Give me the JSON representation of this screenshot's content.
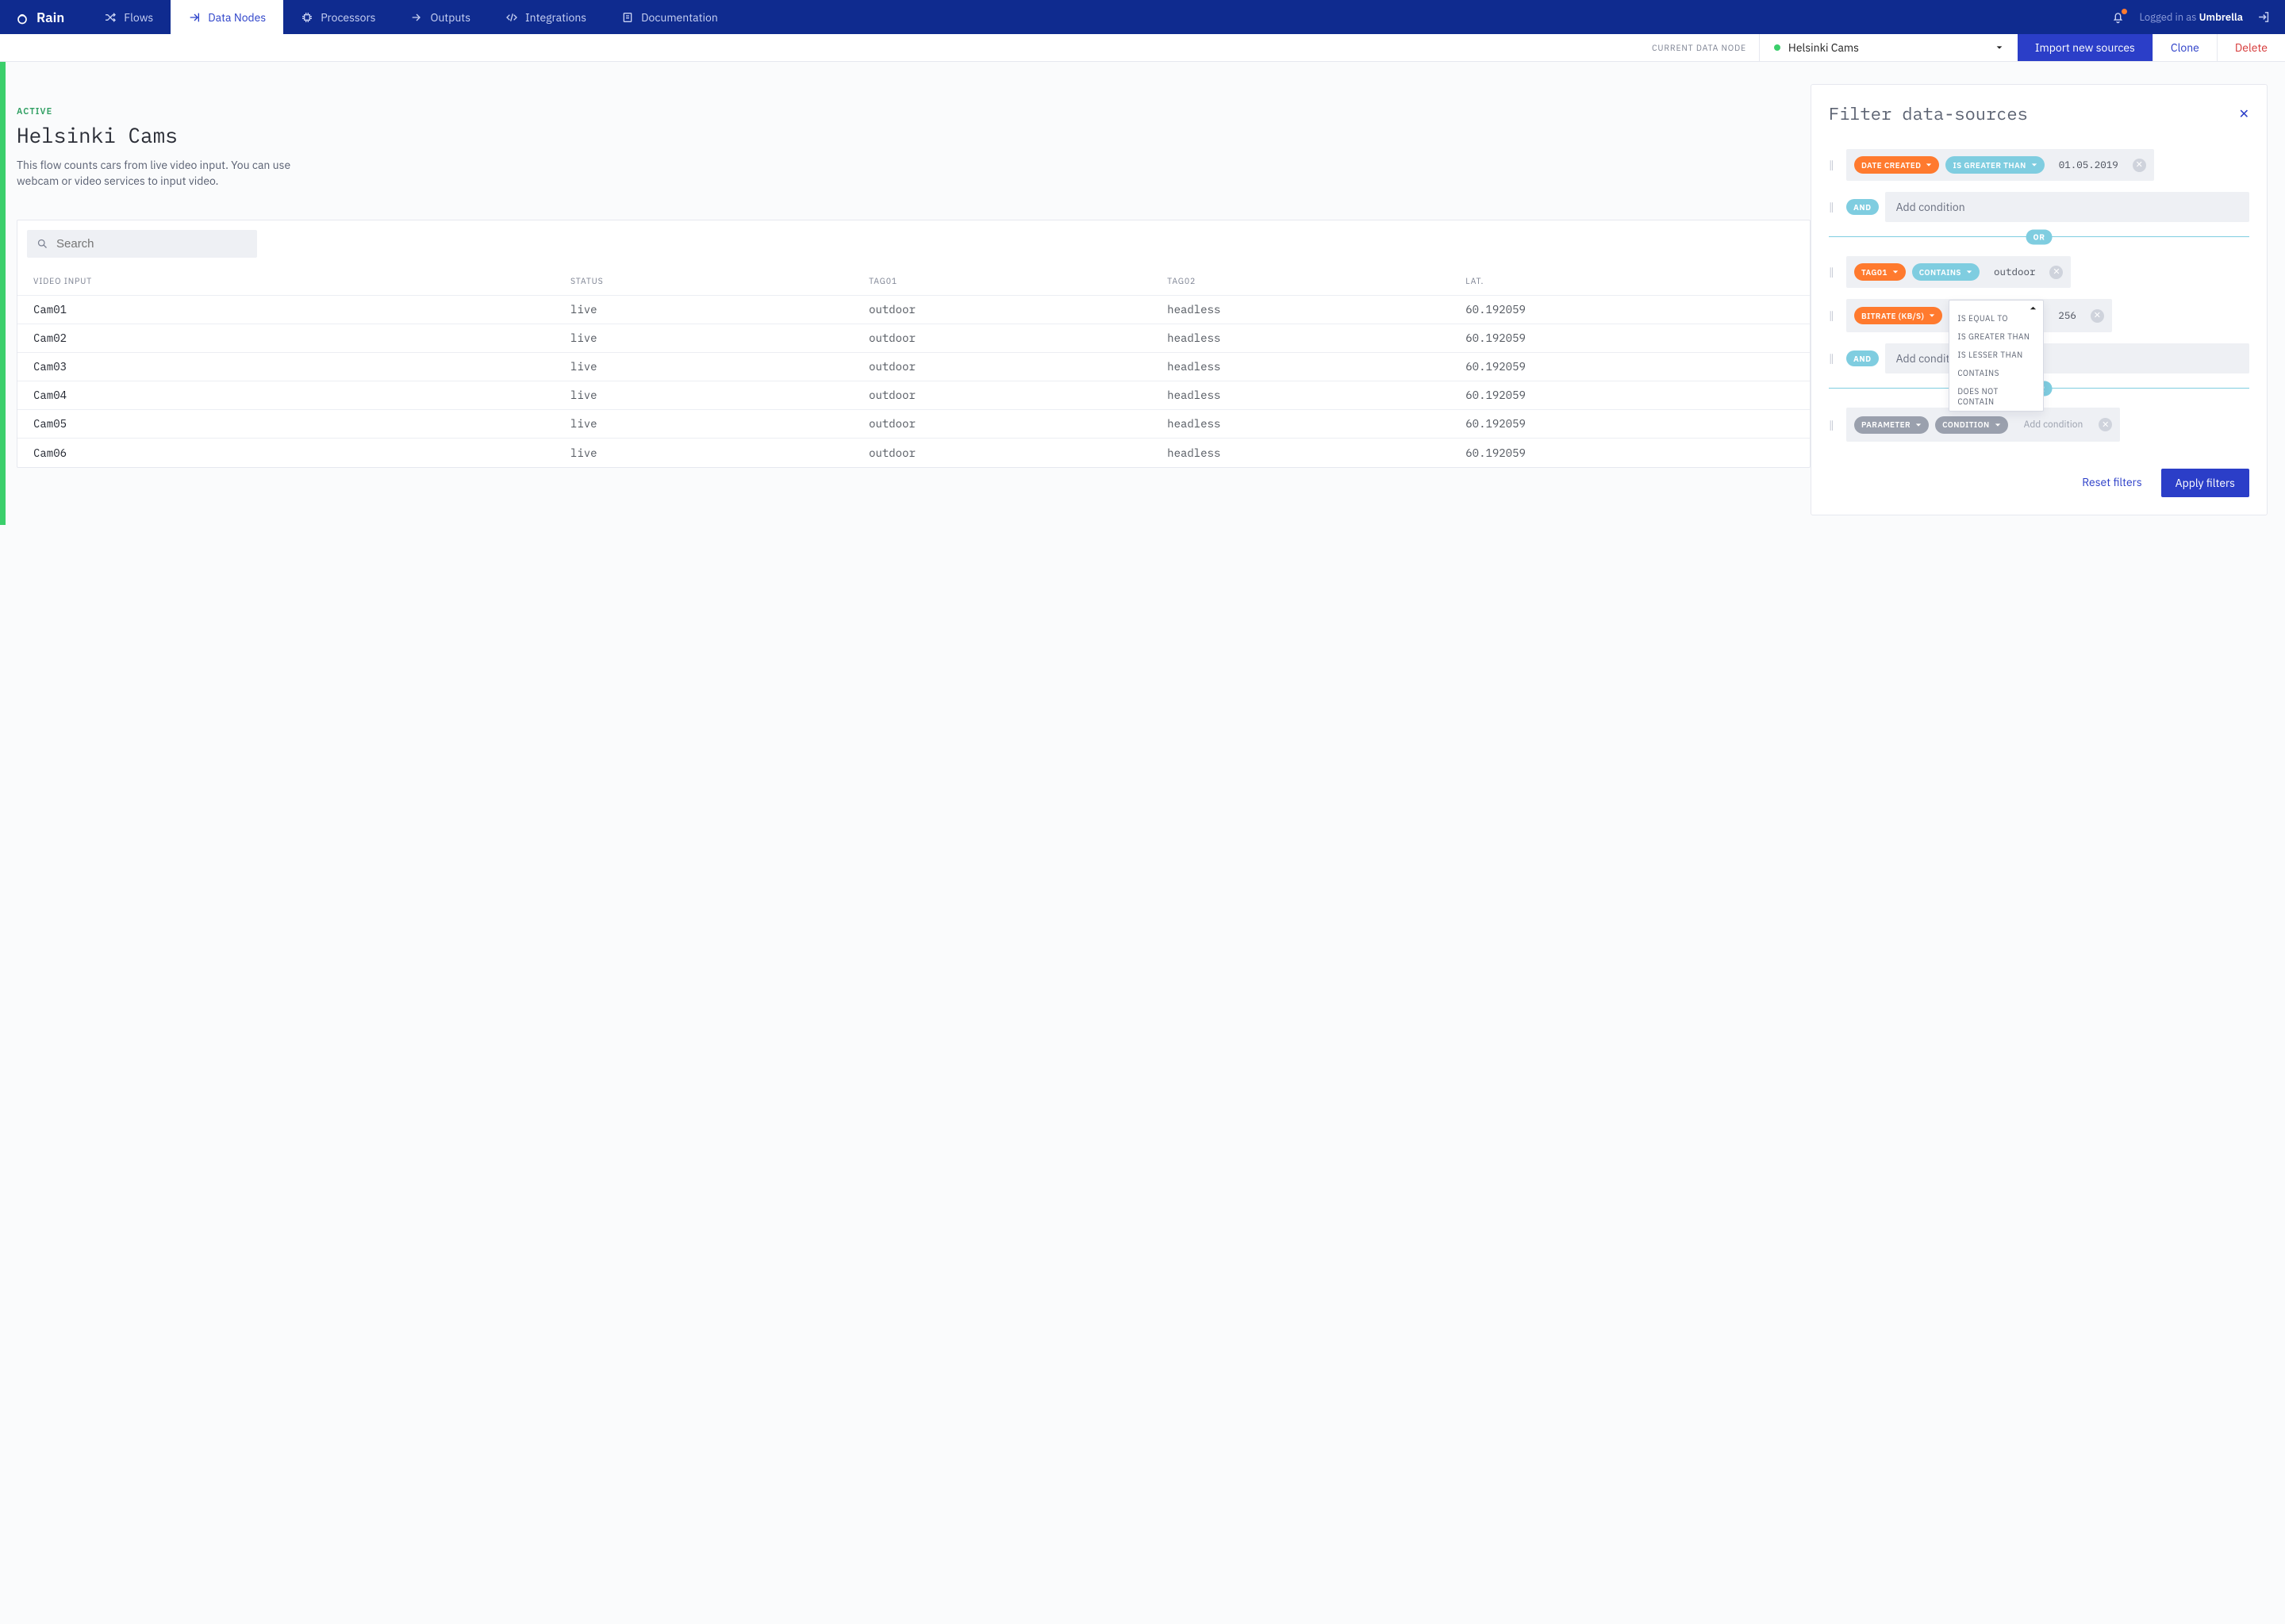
{
  "brand": "Rain",
  "nav": {
    "items": [
      {
        "label": "Flows"
      },
      {
        "label": "Data Nodes",
        "active": true
      },
      {
        "label": "Processors"
      },
      {
        "label": "Outputs"
      },
      {
        "label": "Integrations"
      },
      {
        "label": "Documentation"
      }
    ]
  },
  "auth": {
    "prefix": "Logged in as ",
    "name": "Umbrella"
  },
  "subbar": {
    "label": "CURRENT DATA NODE",
    "node_name": "Helsinki Cams",
    "import": "Import new sources",
    "clone": "Clone",
    "delete": "Delete"
  },
  "hero": {
    "status": "ACTIVE",
    "title": "Helsinki Cams",
    "desc": "This flow counts cars from live video input. You can use webcam or video services to input video."
  },
  "search": {
    "placeholder": "Search"
  },
  "table": {
    "headers": [
      "VIDEO INPUT",
      "STATUS",
      "TAG01",
      "TAG02",
      "LAT."
    ],
    "rows": [
      {
        "c0": "Cam01",
        "c1": "live",
        "c2": "outdoor",
        "c3": "headless",
        "c4": "60.192059"
      },
      {
        "c0": "Cam02",
        "c1": "live",
        "c2": "outdoor",
        "c3": "headless",
        "c4": "60.192059"
      },
      {
        "c0": "Cam03",
        "c1": "live",
        "c2": "outdoor",
        "c3": "headless",
        "c4": "60.192059"
      },
      {
        "c0": "Cam04",
        "c1": "live",
        "c2": "outdoor",
        "c3": "headless",
        "c4": "60.192059"
      },
      {
        "c0": "Cam05",
        "c1": "live",
        "c2": "outdoor",
        "c3": "headless",
        "c4": "60.192059"
      },
      {
        "c0": "Cam06",
        "c1": "live",
        "c2": "outdoor",
        "c3": "headless",
        "c4": "60.192059"
      }
    ]
  },
  "panel": {
    "title": "Filter data-sources",
    "groups": {
      "g1": {
        "param": "DATE CREATED",
        "cond": "IS GREATER THAN",
        "value": "01.05.2019",
        "bool": "AND",
        "add_placeholder": "Add condition"
      },
      "or": "OR",
      "g2": {
        "r1": {
          "param": "TAG01",
          "cond": "CONTAINS",
          "value": "outdoor"
        },
        "r2": {
          "param": "BITRATE (KB/S)",
          "value": "256"
        },
        "bool": "AND",
        "add_placeholder": "Add conditio"
      },
      "g3": {
        "param": "PARAMETER",
        "cond": "CONDITION",
        "value_placeholder": "Add condition"
      }
    },
    "dropdown": {
      "options": [
        "IS EQUAL TO",
        "IS GREATER THAN",
        "IS LESSER THAN",
        "CONTAINS",
        "DOES NOT CONTAIN"
      ]
    },
    "reset": "Reset filters",
    "apply": "Apply filters"
  }
}
